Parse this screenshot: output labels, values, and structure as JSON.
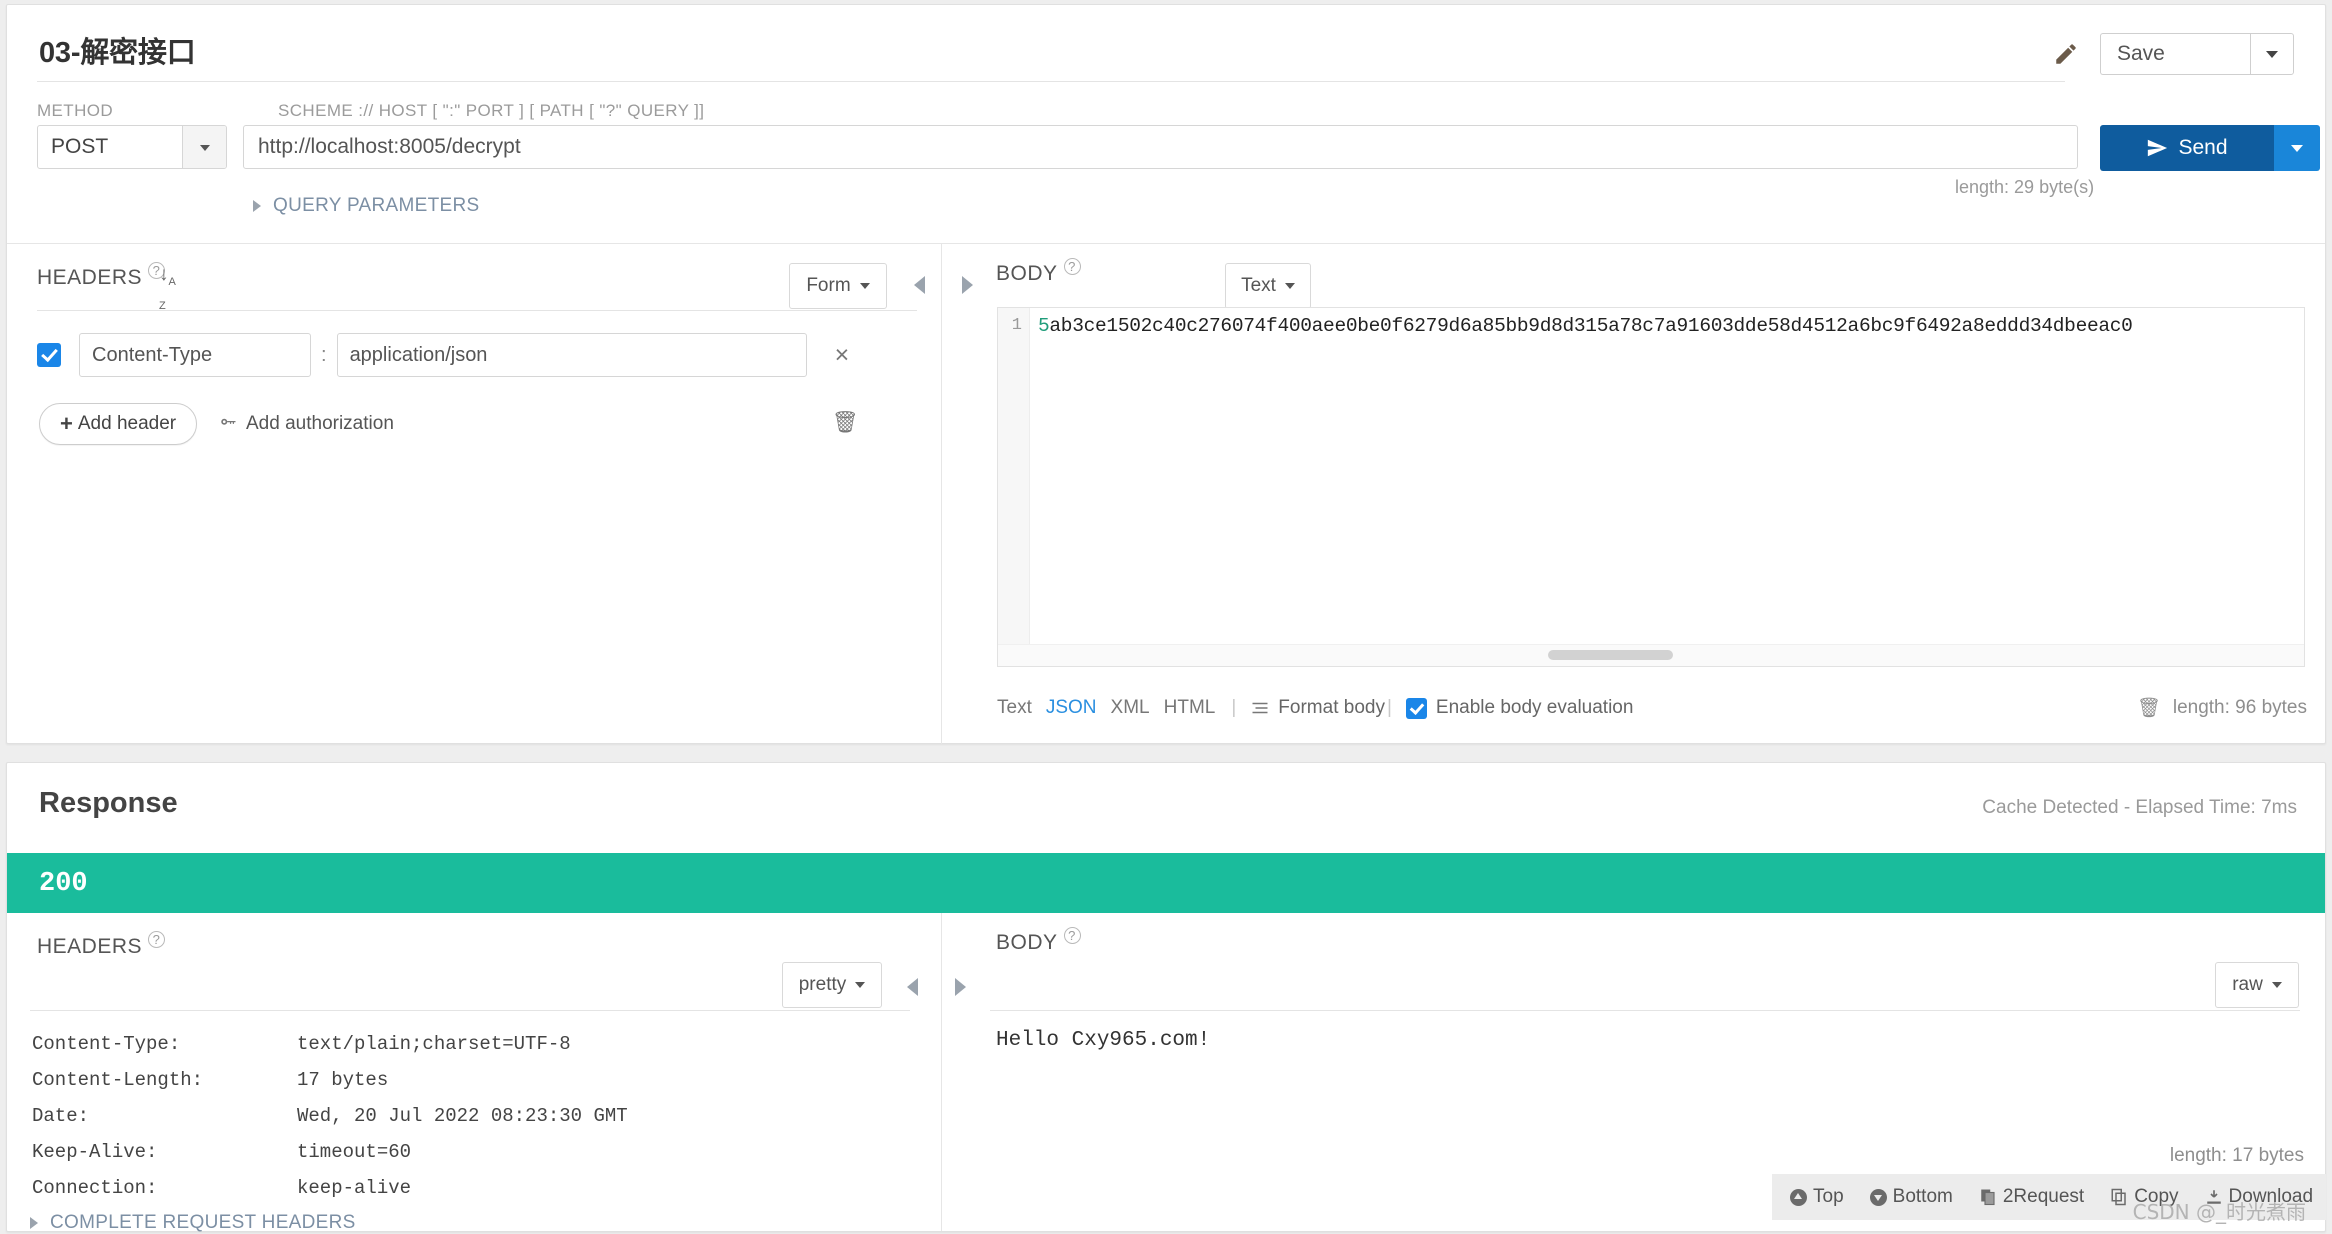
{
  "request": {
    "title": "03-解密接口",
    "edit_icon": "pencil-icon",
    "save_label": "Save",
    "method_label": "METHOD",
    "method_value": "POST",
    "url_label": "SCHEME :// HOST [ \":\" PORT ] [ PATH [ \"?\" QUERY ]]",
    "url_value": "http://localhost:8005/decrypt",
    "send_label": "Send",
    "url_length": "length: 29 byte(s)",
    "query_parameters_label": "QUERY PARAMETERS",
    "headers": {
      "title": "HEADERS",
      "view_mode": "Form",
      "rows": [
        {
          "enabled": true,
          "key": "Content-Type",
          "value": "application/json",
          "remove": "×"
        }
      ],
      "add_header_label": "Add header",
      "add_authorization_label": "Add authorization",
      "trash_icon": "trash-icon",
      "sort_icon": "sort-az-icon"
    },
    "body": {
      "title": "BODY",
      "view_mode": "Text",
      "line_number": "1",
      "content_first_char": "5",
      "content_rest": "ab3ce1502c40c276074f400aee0be0f6279d6a85bb9d8d315a78c7a91603dde58d4512a6bc9f6492a8eddd34dbeeac0",
      "formats": [
        "Text",
        "JSON",
        "XML",
        "HTML"
      ],
      "active_format": "JSON",
      "format_body_label": "Format body",
      "enable_evaluation_label": "Enable body evaluation",
      "enable_evaluation_checked": true,
      "length_label": "length: 96 bytes"
    }
  },
  "response": {
    "title": "Response",
    "cache_info": "Cache Detected - Elapsed Time: 7ms",
    "status_code": "200",
    "headers": {
      "title": "HEADERS",
      "view_mode": "pretty",
      "rows": [
        {
          "key": "Content-Type:",
          "value": "text/plain;charset=UTF-8"
        },
        {
          "key": "Content-Length:",
          "value": "17 bytes"
        },
        {
          "key": "Date:",
          "value": "Wed, 20 Jul 2022 08:23:30 GMT"
        },
        {
          "key": "Keep-Alive:",
          "value": "timeout=60"
        },
        {
          "key": "Connection:",
          "value": "keep-alive"
        }
      ],
      "complete_request_headers_label": "COMPLETE REQUEST HEADERS"
    },
    "body": {
      "title": "BODY",
      "view_mode": "raw",
      "content": "Hello Cxy965.com!",
      "length_label": "length: 17 bytes"
    },
    "toolbar": [
      {
        "label": "Top",
        "icon": "arrow-up-circle-icon"
      },
      {
        "label": "Bottom",
        "icon": "arrow-down-circle-icon"
      },
      {
        "label": "2Request",
        "icon": "copy-to-request-icon"
      },
      {
        "label": "Copy",
        "icon": "copy-icon"
      },
      {
        "label": "Download",
        "icon": "download-icon"
      }
    ]
  },
  "watermark": "CSDN @_时光煮雨",
  "colors": {
    "send_button": "#0f5c9e",
    "send_caret": "#1a86d9",
    "status_bar": "#1abc9c",
    "accent_link": "#2a8fe0",
    "checkbox": "#1a86e8",
    "section_link": "#7c8fa4"
  }
}
